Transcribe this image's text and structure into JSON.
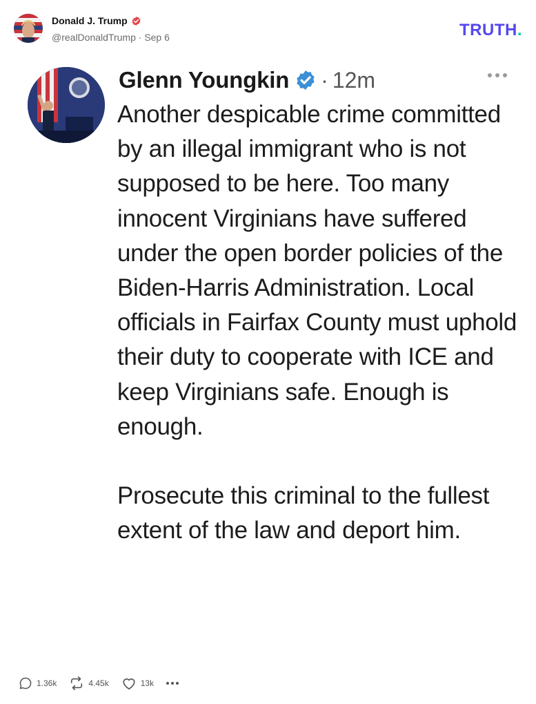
{
  "post": {
    "author_name": "Donald J. Trump",
    "author_handle": "@realDonaldTrump",
    "date": "Sep 6",
    "meta_separator": " · "
  },
  "brand": {
    "logo_text": "TRUTH",
    "logo_dot": ".",
    "color_primary": "#5448ee",
    "color_accent": "#00c7b1",
    "verified_color": "#e5484d"
  },
  "tweet": {
    "author_name": "Glenn Youngkin",
    "separator": "·",
    "time": "12m",
    "verified_color": "#1d9bf0",
    "paragraph_1": "Another despicable crime committed by an illegal immigrant who is not supposed to be here. Too many innocent Virginians have suffered under the open border policies of the Biden-Harris Administration. Local officials in Fairfax County must uphold their duty to cooperate with ICE and keep Virginians safe. Enough is enough.",
    "paragraph_2": "Prosecute this criminal to the fullest extent of the law and deport him."
  },
  "actions": {
    "replies": "1.36k",
    "retruths": "4.45k",
    "likes": "13k"
  },
  "icons": {
    "reply": "comment-icon",
    "retruth": "retruth-icon",
    "like": "heart-icon",
    "more": "more-icon",
    "verified": "verified-badge-icon"
  }
}
